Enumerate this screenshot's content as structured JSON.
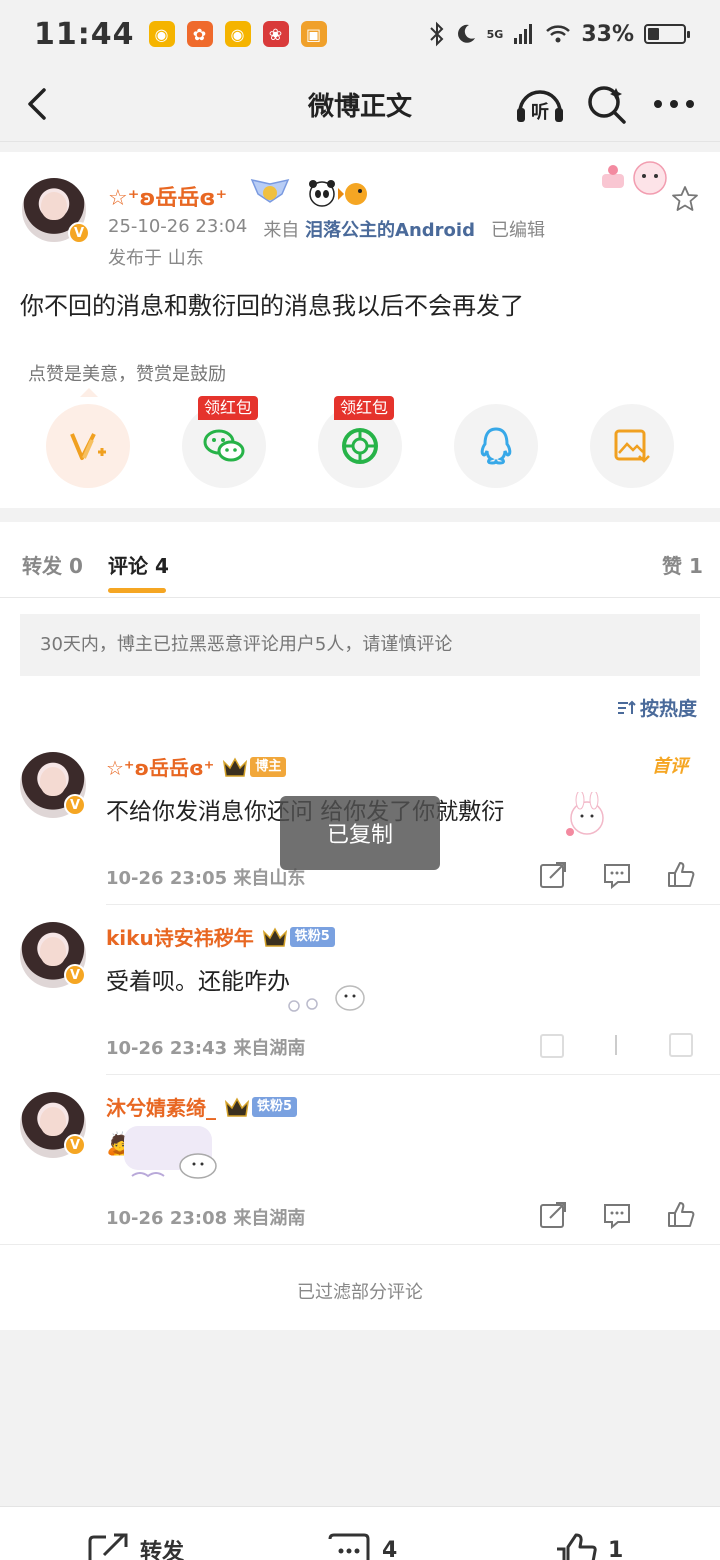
{
  "status_bar": {
    "time": "11:44",
    "network": "5G",
    "battery_text": "33%",
    "battery_level": 0.33
  },
  "nav": {
    "title": "微博正文",
    "listen_label": "听"
  },
  "post": {
    "username": "☆⁺ʚ岳岳ɞ⁺",
    "date": "25-10-26 23:04",
    "source_prefix": "来自",
    "source": "泪落公主的Android",
    "edited": "已编辑",
    "location": "发布于 山东",
    "content": "你不回的消息和敷衍回的消息我以后不会再发了",
    "reward_tip": "点赞是美意，赞赏是鼓励",
    "share_tags": [
      "领红包",
      "领红包"
    ],
    "vip_badge": "V"
  },
  "tabs": {
    "repost": "转发 0",
    "comment": "评论 4",
    "like": "赞 1"
  },
  "comments_section": {
    "notice": "30天内，博主已拉黑恶意评论用户5人，请谨慎评论",
    "sort_label": "按热度",
    "first_badge": "首评",
    "filtered_text": "已过滤部分评论",
    "items": [
      {
        "name": "☆⁺ʚ岳岳ɞ⁺",
        "tag": "博主",
        "text": "不给你发消息你还问 给你发了你就敷衍",
        "time": "10-26 23:05 来自山东"
      },
      {
        "name": "kiku诗安祎秽年",
        "tag": "铁粉5",
        "text": "受着呗。还能咋办",
        "time": "10-26 23:43 来自湖南"
      },
      {
        "name": "沐兮婧素绮_",
        "tag": "铁粉5",
        "text": "🙇",
        "time": "10-26 23:08 来自湖南"
      }
    ]
  },
  "toast": "已复制",
  "bottom_bar": {
    "repost": "转发",
    "comment_count": "4",
    "like_count": "1"
  },
  "colors": {
    "accent": "#f5a623",
    "username": "#e86722",
    "link": "#4a6a9a"
  }
}
